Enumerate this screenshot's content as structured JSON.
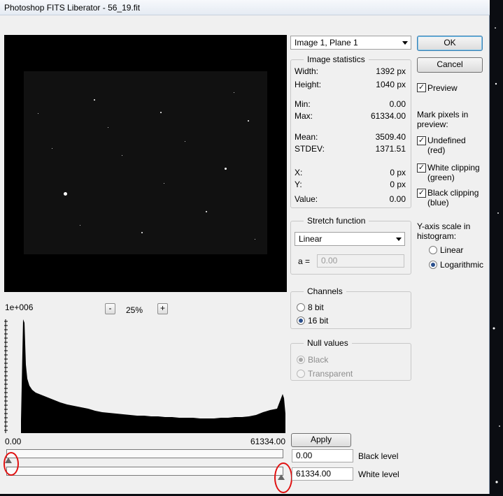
{
  "window": {
    "title": "Photoshop FITS Liberator - 56_19.fit"
  },
  "image_select": {
    "value": "Image 1, Plane 1"
  },
  "buttons": {
    "ok": "OK",
    "cancel": "Cancel",
    "apply": "Apply"
  },
  "preview_toggle": {
    "label": "Preview",
    "checked": true
  },
  "statistics": {
    "title": "Image statistics",
    "width": {
      "label": "Width:",
      "value": "1392 px"
    },
    "height": {
      "label": "Height:",
      "value": "1040 px"
    },
    "min": {
      "label": "Min:",
      "value": "0.00"
    },
    "max": {
      "label": "Max:",
      "value": "61334.00"
    },
    "mean": {
      "label": "Mean:",
      "value": "3509.40"
    },
    "stdev": {
      "label": "STDEV:",
      "value": "1371.51"
    },
    "x": {
      "label": "X:",
      "value": "0 px"
    },
    "y": {
      "label": "Y:",
      "value": "0 px"
    },
    "pixel_value": {
      "label": "Value:",
      "value": "0.00"
    }
  },
  "mark_pixels": {
    "heading_line1": "Mark pixels in",
    "heading_line2": "preview:",
    "undefined": {
      "line1": "Undefined",
      "line2": "(red)",
      "checked": true
    },
    "white_clipping": {
      "line1": "White clipping",
      "line2": "(green)",
      "checked": true
    },
    "black_clipping": {
      "line1": "Black clipping",
      "line2": "(blue)",
      "checked": true
    }
  },
  "stretch": {
    "title": "Stretch function",
    "function": "Linear",
    "a_label": "a =",
    "a_value": "0.00"
  },
  "yaxis": {
    "heading_line1": "Y-axis scale in",
    "heading_line2": "histogram:",
    "options": [
      "Linear",
      "Logarithmic"
    ],
    "selected": "Logarithmic"
  },
  "channels": {
    "title": "Channels",
    "options": [
      "8 bit",
      "16 bit"
    ],
    "selected": "16 bit"
  },
  "null_values": {
    "title": "Null values",
    "options": [
      "Black",
      "Transparent"
    ],
    "selected": "Black",
    "enabled": false
  },
  "zoom": {
    "minus": "-",
    "plus": "+",
    "value": "25%"
  },
  "histogram": {
    "ymax_label": "1e+006",
    "xmin_label": "0.00",
    "xmax_label": "61334.00"
  },
  "levels": {
    "black_value": "0.00",
    "black_label": "Black level",
    "white_value": "61334.00",
    "white_label": "White level"
  },
  "colors": {
    "marker": "#e01010",
    "dialog_bg": "#f0f0f0"
  }
}
